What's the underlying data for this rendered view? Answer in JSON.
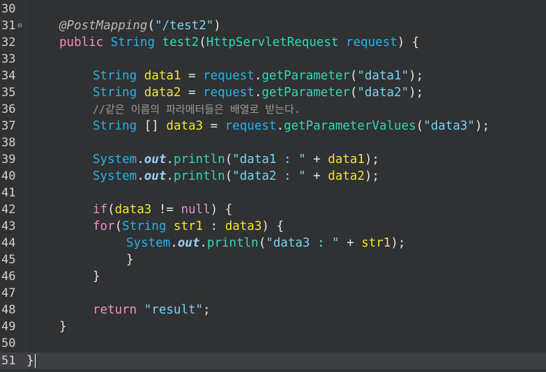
{
  "editor": {
    "lines": [
      {
        "number": "30"
      },
      {
        "number": "31",
        "annotation": "@PostMapping",
        "paren_open": "(",
        "path": "\"/test2\"",
        "paren_close": ")"
      },
      {
        "number": "32",
        "kw_public": "public",
        "type_string": "String",
        "method": "test2",
        "paren_open": "(",
        "param_type": "HttpServletRequest",
        "param_name": "request",
        "rest": ") {"
      },
      {
        "number": "33"
      },
      {
        "number": "34",
        "type": "String",
        "var": "data1",
        "eq": " = ",
        "obj": "request",
        "dot": ".",
        "method": "getParameter",
        "paren_open": "(",
        "arg": "\"data1\"",
        "end": ");"
      },
      {
        "number": "35",
        "type": "String",
        "var": "data2",
        "eq": " = ",
        "obj": "request",
        "dot": ".",
        "method": "getParameter",
        "paren_open": "(",
        "arg": "\"data2\"",
        "end": ");"
      },
      {
        "number": "36",
        "comment": "//같은 이름의 파라메터들은 배열로 받는다."
      },
      {
        "number": "37",
        "type": "String",
        "brackets": " [] ",
        "var": "data3",
        "eq": " = ",
        "obj": "request",
        "dot": ".",
        "method": "getParameterValues",
        "paren_open": "(",
        "arg": "\"data3\"",
        "end": ");"
      },
      {
        "number": "38"
      },
      {
        "number": "39",
        "cls": "System",
        "dot1": ".",
        "field": "out",
        "dot2": ".",
        "method": "println",
        "paren_open": "(",
        "arg": "\"data1 : \"",
        "plus": " + ",
        "var": "data1",
        "end": ");"
      },
      {
        "number": "40",
        "cls": "System",
        "dot1": ".",
        "field": "out",
        "dot2": ".",
        "method": "println",
        "paren_open": "(",
        "arg": "\"data2 : \"",
        "plus": " + ",
        "var": "data2",
        "end": ");"
      },
      {
        "number": "41"
      },
      {
        "number": "42",
        "kw": "if",
        "paren_open": "(",
        "var": "data3",
        "op": " != ",
        "null": "null",
        "end": ") {"
      },
      {
        "number": "43",
        "kw": "for",
        "paren_open": "(",
        "type": "String",
        "var": "str1",
        "colon": " : ",
        "var2": "data3",
        "end": ") {"
      },
      {
        "number": "44",
        "cls": "System",
        "dot1": ".",
        "field": "out",
        "dot2": ".",
        "method": "println",
        "paren_open": "(",
        "arg": "\"data3 : \"",
        "plus": " + ",
        "var": "str1",
        "end": ");"
      },
      {
        "number": "45",
        "brace": "}"
      },
      {
        "number": "46",
        "brace": "}"
      },
      {
        "number": "47"
      },
      {
        "number": "48",
        "kw": "return",
        "arg": "\"result\"",
        "end": ";"
      },
      {
        "number": "49",
        "brace": "}"
      },
      {
        "number": "50"
      },
      {
        "number": "51",
        "brace": "}"
      }
    ],
    "colors": {
      "background": "#2f3133",
      "current_line": "#3d3f42",
      "keyword": "#f38fc6",
      "type": "#2bb0e8",
      "method": "#36d6b8",
      "variable": "#f5e62b",
      "string": "#78d4f3",
      "comment": "#9a9a9a"
    }
  }
}
